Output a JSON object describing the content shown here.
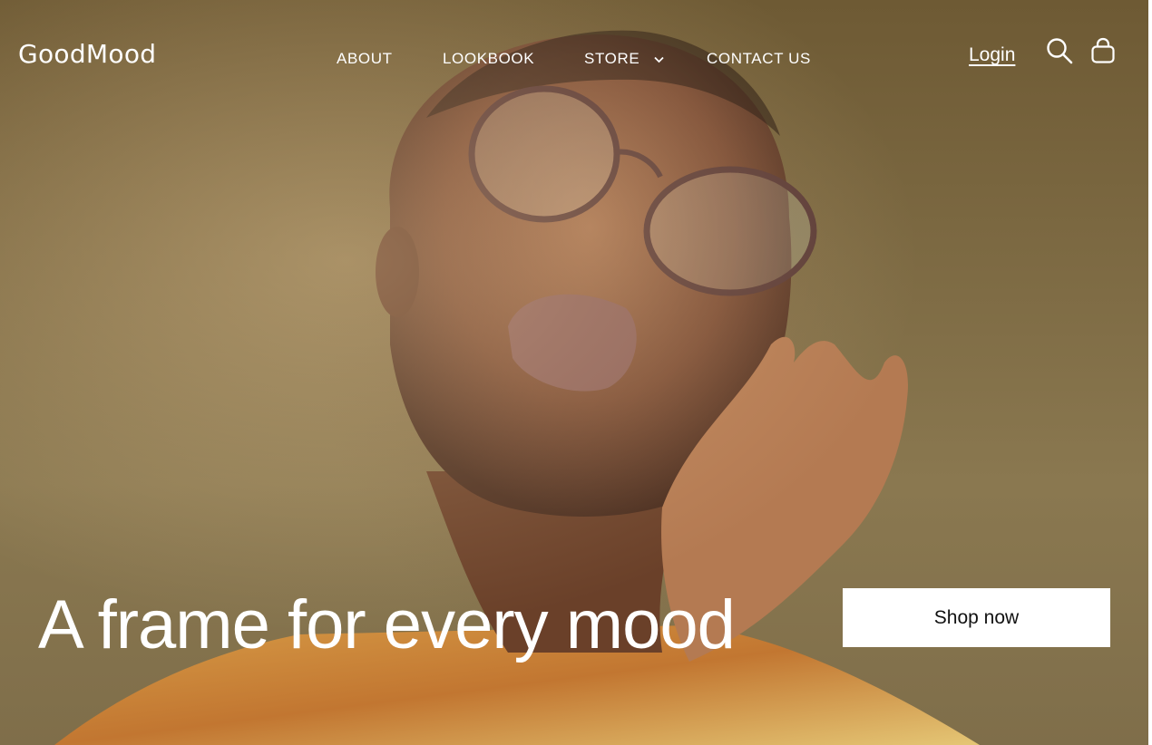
{
  "brand": {
    "name": "GoodMood"
  },
  "nav": {
    "items": [
      {
        "label": "ABOUT"
      },
      {
        "label": "LOOKBOOK"
      },
      {
        "label": "STORE"
      },
      {
        "label": "CONTACT US"
      }
    ]
  },
  "header": {
    "login_label": "Login",
    "icons": [
      "search-icon",
      "shopping-bag-icon",
      "chevron-down-icon"
    ]
  },
  "hero": {
    "headline": "A frame for every mood",
    "cta_label": "Shop now"
  },
  "colors": {
    "background": "#7a6740",
    "text": "#ffffff",
    "button_bg": "#ffffff",
    "button_text": "#111111"
  }
}
